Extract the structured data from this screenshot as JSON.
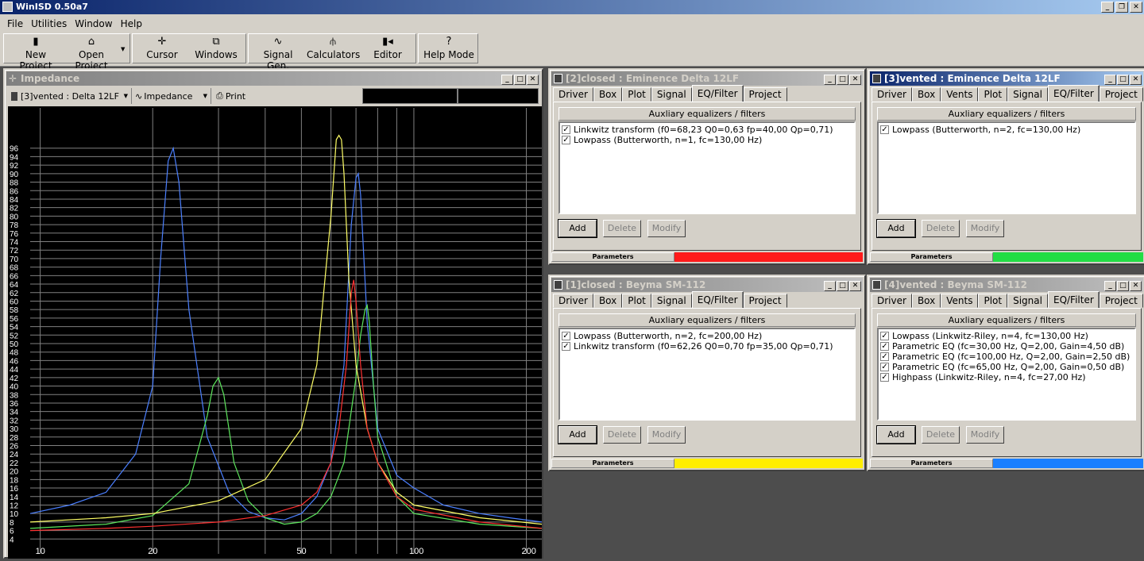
{
  "app": {
    "title": "WinISD 0.50a7"
  },
  "menu": [
    "File",
    "Utilities",
    "Window",
    "Help"
  ],
  "toolbar": [
    {
      "label": "New Project",
      "icon": "new-project-icon",
      "glyph": "▮"
    },
    {
      "label": "Open Project",
      "icon": "open-folder-icon",
      "glyph": "⌂"
    },
    {
      "label": "Cursor",
      "icon": "cursor-icon",
      "glyph": "✛"
    },
    {
      "label": "Windows",
      "icon": "windows-icon",
      "glyph": "⧉"
    },
    {
      "label": "Signal Gen.",
      "icon": "signal-gen-icon",
      "glyph": "∿"
    },
    {
      "label": "Calculators",
      "icon": "calculators-icon",
      "glyph": "⫛"
    },
    {
      "label": "Editor",
      "icon": "editor-icon",
      "glyph": "▮◂"
    },
    {
      "label": "Help Mode",
      "icon": "help-icon",
      "glyph": "?"
    }
  ],
  "impedance": {
    "title": "Impedance",
    "project_select": "[3]vented : Delta 12LF",
    "plot_select": "Impedance",
    "print": "Print",
    "chart_data": {
      "type": "line",
      "title": "",
      "xlabel": "",
      "ylabel": "",
      "xscale": "log",
      "xlim": [
        9.4,
        220
      ],
      "ylim": [
        0,
        100
      ],
      "grid": true,
      "xticks": [
        10,
        20,
        50,
        100,
        200
      ],
      "xgrid": [
        10,
        20,
        30,
        40,
        50,
        60,
        70,
        80,
        90,
        100,
        200
      ],
      "yticks": [
        4,
        6,
        8,
        10,
        12,
        14,
        16,
        18,
        20,
        22,
        24,
        26,
        28,
        30,
        32,
        34,
        36,
        38,
        40,
        42,
        44,
        46,
        48,
        50,
        52,
        54,
        56,
        58,
        60,
        62,
        64,
        66,
        68,
        70,
        72,
        74,
        76,
        78,
        80,
        82,
        84,
        86,
        88,
        90,
        92,
        94,
        96
      ],
      "series": [
        {
          "color": "#4a7fff",
          "x": [
            9.4,
            12,
            15,
            18,
            20,
            21,
            22,
            22.7,
            23.5,
            25,
            28,
            32,
            36,
            40,
            45,
            50,
            55,
            60,
            65,
            68,
            70,
            71,
            72,
            75,
            80,
            90,
            100,
            120,
            150,
            180,
            220
          ],
          "values": [
            10,
            12,
            15,
            24,
            40,
            70,
            93,
            96,
            88,
            58,
            28,
            15,
            10.5,
            9,
            8.5,
            10,
            14,
            22,
            45,
            78,
            89,
            90,
            85,
            55,
            30,
            19,
            16,
            12,
            10,
            9,
            8
          ]
        },
        {
          "color": "#5ce65c",
          "x": [
            9.4,
            15,
            20,
            25,
            28,
            29,
            30,
            31,
            33,
            36,
            40,
            45,
            50,
            55,
            60,
            65,
            70,
            72,
            74,
            75,
            76,
            78,
            80,
            90,
            100,
            150,
            220
          ],
          "values": [
            6.5,
            7.5,
            9.5,
            17,
            33,
            40,
            42,
            38,
            22,
            13,
            9,
            7.5,
            8,
            10,
            14,
            22,
            42,
            52,
            58,
            59,
            55,
            40,
            28,
            14,
            10,
            7.5,
            6.5
          ]
        },
        {
          "color": "#ffff66",
          "x": [
            9.4,
            15,
            20,
            30,
            40,
            50,
            55,
            60,
            62,
            63,
            64,
            65,
            67,
            70,
            75,
            80,
            90,
            100,
            150,
            220
          ],
          "values": [
            8,
            9,
            10,
            13,
            18,
            30,
            45,
            80,
            98,
            100,
            98,
            90,
            65,
            45,
            30,
            22,
            15,
            12,
            9,
            7.5
          ]
        },
        {
          "color": "#ff3030",
          "x": [
            9.4,
            15,
            20,
            30,
            40,
            50,
            55,
            60,
            63,
            66,
            68,
            69,
            70,
            72,
            75,
            80,
            90,
            100,
            150,
            220
          ],
          "values": [
            6,
            6.5,
            7,
            8,
            9.5,
            12,
            15,
            22,
            30,
            45,
            62,
            65,
            60,
            45,
            30,
            22,
            14,
            11,
            8,
            6.5
          ]
        }
      ]
    }
  },
  "windows": [
    {
      "title": "[2]closed : Eminence Delta 12LF",
      "active": false,
      "tabs": [
        "Driver",
        "Box",
        "Plot",
        "Signal",
        "EQ/Filter",
        "Project"
      ],
      "selected_tab": "EQ/Filter",
      "header": "Auxliary equalizers / filters",
      "items": [
        "Linkwitz transform (f0=68,23 Q0=0,63 fp=40,00 Qp=0,71)",
        "Lowpass (Butterworth, n=1, fc=130,00 Hz)"
      ],
      "buttons": [
        "Add",
        "Delete",
        "Modify"
      ],
      "params_label": "Parameters",
      "color": "#ff1a1a"
    },
    {
      "title": "[3]vented : Eminence Delta 12LF",
      "active": true,
      "tabs": [
        "Driver",
        "Box",
        "Vents",
        "Plot",
        "Signal",
        "EQ/Filter",
        "Project"
      ],
      "selected_tab": "EQ/Filter",
      "header": "Auxliary equalizers / filters",
      "items": [
        "Lowpass (Butterworth, n=2, fc=130,00 Hz)"
      ],
      "buttons": [
        "Add",
        "Delete",
        "Modify"
      ],
      "params_label": "Parameters",
      "color": "#22dd44"
    },
    {
      "title": "[1]closed : Beyma SM-112",
      "active": false,
      "tabs": [
        "Driver",
        "Box",
        "Plot",
        "Signal",
        "EQ/Filter",
        "Project"
      ],
      "selected_tab": "EQ/Filter",
      "header": "Auxliary equalizers / filters",
      "items": [
        "Lowpass (Butterworth, n=2, fc=200,00 Hz)",
        "Linkwitz transform (f0=62,26 Q0=0,70 fp=35,00 Qp=0,71)"
      ],
      "buttons": [
        "Add",
        "Delete",
        "Modify"
      ],
      "params_label": "Parameters",
      "color": "#ffee00"
    },
    {
      "title": "[4]vented : Beyma SM-112",
      "active": false,
      "tabs": [
        "Driver",
        "Box",
        "Vents",
        "Plot",
        "Signal",
        "EQ/Filter",
        "Project"
      ],
      "selected_tab": "EQ/Filter",
      "header": "Auxliary equalizers / filters",
      "items": [
        "Lowpass (Linkwitz-Riley, n=4, fc=130,00 Hz)",
        "Parametric EQ (fc=30,00 Hz, Q=2,00, Gain=4,50 dB)",
        "Parametric EQ (fc=100,00 Hz, Q=2,00, Gain=2,50 dB)",
        "Parametric EQ (fc=65,00 Hz, Q=2,00, Gain=0,50 dB)",
        "Highpass (Linkwitz-Riley, n=4, fc=27,00 Hz)"
      ],
      "buttons": [
        "Add",
        "Delete",
        "Modify"
      ],
      "params_label": "Parameters",
      "color": "#1a7fff"
    }
  ]
}
